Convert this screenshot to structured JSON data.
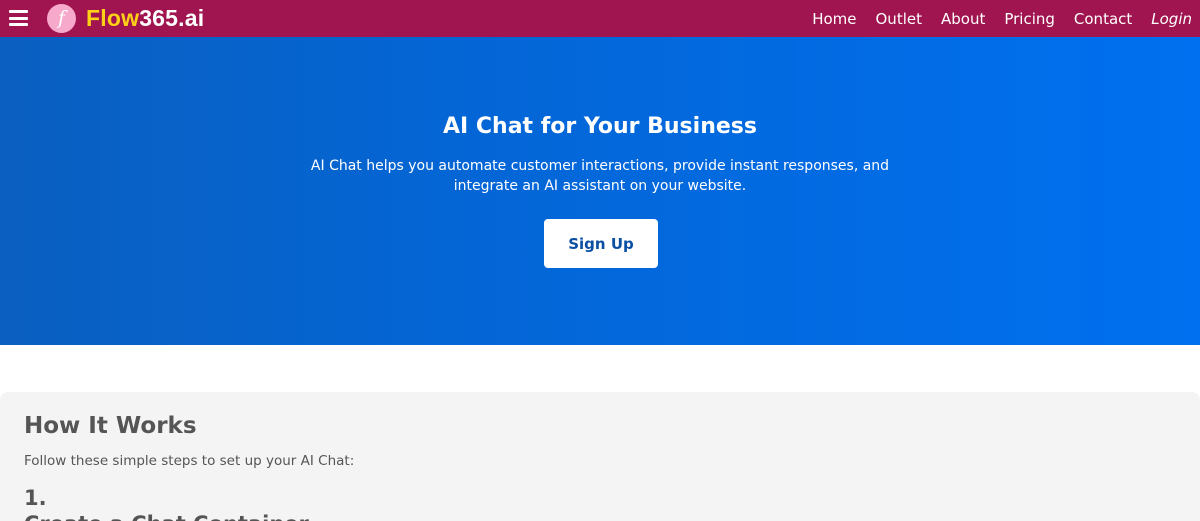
{
  "nav": {
    "logo_letter": "f",
    "brand_part1": "Flow",
    "brand_part2": "365.ai",
    "links": [
      "Home",
      "Outlet",
      "About",
      "Pricing",
      "Contact"
    ],
    "login": "Login",
    "colors": {
      "bar": "#a0154f",
      "brand_accent": "#fcd116",
      "logo_circle": "#f7a9cb"
    }
  },
  "hero": {
    "title": "AI Chat for Your Business",
    "description": "AI Chat helps you automate customer interactions, provide instant responses, and integrate an AI assistant on your website.",
    "cta": "Sign Up"
  },
  "how_it_works": {
    "title": "How It Works",
    "subtitle": "Follow these simple steps to set up your AI Chat:",
    "step_number": "1.",
    "step_title": "Create a Chat Container"
  }
}
